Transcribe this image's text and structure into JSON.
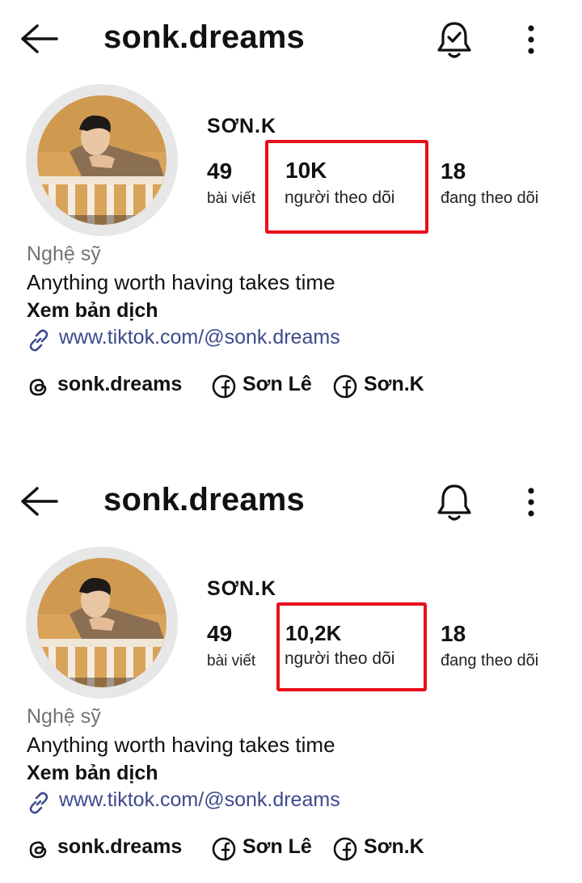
{
  "screens": [
    {
      "header": {
        "username": "sonk.dreams"
      },
      "profile": {
        "display_name": "SƠN.K",
        "stats": [
          {
            "value": "49",
            "label": "bài viết"
          },
          {
            "value": "10K",
            "label": "người theo dõi"
          },
          {
            "value": "18",
            "label": "đang theo dõi"
          }
        ],
        "category": "Nghệ sỹ",
        "bio": "Anything worth having takes time",
        "translate": "Xem bản dịch",
        "link": "www.tiktok.com/@sonk.dreams",
        "socials": [
          {
            "icon": "threads-icon",
            "label": "sonk.dreams"
          },
          {
            "icon": "facebook-icon",
            "label": "Sơn Lê"
          },
          {
            "icon": "facebook-icon",
            "label": "Sơn.K"
          }
        ]
      },
      "bell_state": "subscribed"
    },
    {
      "header": {
        "username": "sonk.dreams"
      },
      "profile": {
        "display_name": "SƠN.K",
        "stats": [
          {
            "value": "49",
            "label": "bài viết"
          },
          {
            "value": "10,2K",
            "label": "người theo dõi"
          },
          {
            "value": "18",
            "label": "đang theo dõi"
          }
        ],
        "category": "Nghệ sỹ",
        "bio": "Anything worth having takes time",
        "translate": "Xem bản dịch",
        "link": "www.tiktok.com/@sonk.dreams",
        "socials": [
          {
            "icon": "threads-icon",
            "label": "sonk.dreams"
          },
          {
            "icon": "facebook-icon",
            "label": "Sơn Lê"
          },
          {
            "icon": "facebook-icon",
            "label": "Sơn.K"
          }
        ]
      },
      "bell_state": "default"
    }
  ],
  "colors": {
    "highlight": "#e8101a",
    "link": "#3d4a8c",
    "muted": "#737373"
  }
}
